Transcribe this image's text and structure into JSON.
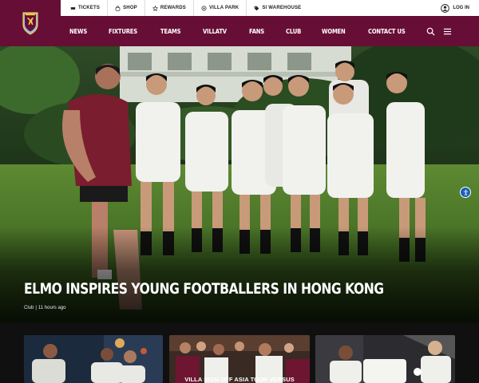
{
  "utility_bar": {
    "links": [
      {
        "label": "Tickets",
        "icon": "ticket-icon"
      },
      {
        "label": "Shop",
        "icon": "bag-icon"
      },
      {
        "label": "Rewards",
        "icon": "star-icon"
      },
      {
        "label": "Villa Park",
        "icon": "stadium-icon"
      },
      {
        "label": "SI Warehouse",
        "icon": "tag-icon"
      }
    ],
    "login_label": "Log In"
  },
  "nav": {
    "items": [
      "News",
      "Fixtures",
      "Teams",
      "VillaTV",
      "Fans",
      "Club",
      "Women",
      "Contact Us"
    ],
    "icons": [
      "search-icon",
      "menu-icon"
    ]
  },
  "hero": {
    "title": "Elmo inspires young footballers in Hong Kong",
    "category": "Club",
    "separator": "|",
    "time": "11 hours ago"
  },
  "cards": [
    {
      "title": ""
    },
    {
      "title": "Villa sign off Asia tour versus"
    },
    {
      "title": ""
    }
  ],
  "colors": {
    "brand_claret": "#670e36",
    "brand_blue": "#95bfe5",
    "strip_background": "#101010"
  }
}
